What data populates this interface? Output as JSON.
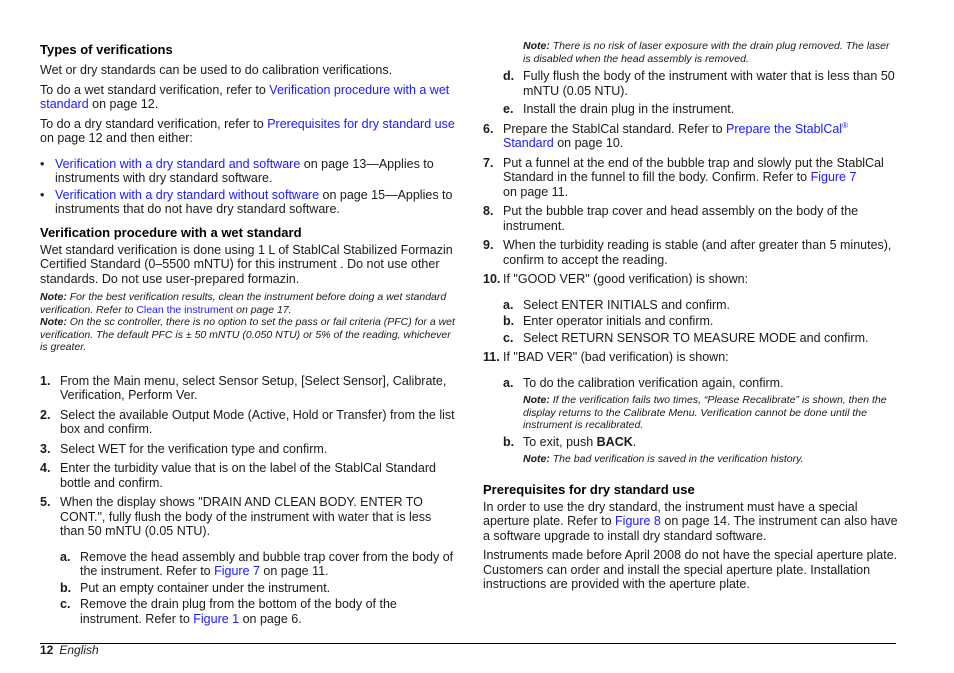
{
  "left": {
    "types": {
      "heading": "Types of verifications",
      "p1": "Wet or dry standards can be used to do calibration verifications.",
      "p2_pre": "To do a wet standard verification, refer to ",
      "p2_link": "Verification procedure with a wet standard",
      "p2_post": " on page 12.",
      "p3_pre": "To do a dry standard verification, refer to ",
      "p3_link": "Prerequisites for dry standard use",
      "p3_post": " on page 12 and then either:",
      "bullets": [
        {
          "link": "Verification with a dry standard and software",
          "text": " on page 13—Applies to instruments with dry standard software."
        },
        {
          "link": "Verification with a dry standard without software",
          "text": " on page 15—Applies to instruments that do not have dry standard software."
        }
      ],
      "bullet_glyph": "•"
    },
    "wet": {
      "heading": "Verification procedure with a wet standard",
      "intro": "Wet standard verification is done using 1 L of StablCal Stabilized Formazin Certified Standard (0–5500 mNTU) for this instrument . Do not use other standards. Do not use user-prepared formazin.",
      "note1_label": "Note:",
      "note1_pre": " For the best verification results, clean the instrument before doing a wet standard verification. Refer to ",
      "note1_link": "Clean the instrument",
      "note1_post": " on page 17.",
      "note2_label": "Note:",
      "note2_text": " On the sc controller, there is no option to set the pass or fail criteria (PFC) for a wet verification. The default PFC is ± 50 mNTU (0.050 NTU) or 5% of the reading, whichever is greater.",
      "steps": [
        {
          "num": "1.",
          "text": "From the Main menu, select Sensor Setup, [Select Sensor], Calibrate, Verification, Perform Ver."
        },
        {
          "num": "2.",
          "text": "Select the available Output Mode (Active, Hold or Transfer) from the list box and confirm."
        },
        {
          "num": "3.",
          "text": "Select WET for the verification type and confirm."
        },
        {
          "num": "4.",
          "text": "Enter the turbidity value that is on the label of the StablCal Standard bottle and confirm."
        },
        {
          "num": "5.",
          "text": "When the display shows \"DRAIN AND CLEAN BODY. ENTER TO CONT.\", fully flush the body of the instrument with water that is less than 50 mNTU (0.05 NTU)."
        }
      ],
      "step5_subs": [
        {
          "letter": "a.",
          "pre": "Remove the head assembly and bubble trap cover from the body of the instrument. Refer to ",
          "link": "Figure 7",
          "post": " on page 11."
        },
        {
          "letter": "b.",
          "pre": "Put an empty container under the instrument.",
          "link": "",
          "post": ""
        },
        {
          "letter": "c.",
          "pre": "Remove the drain plug from the bottom of the body of the instrument. Refer to ",
          "link": "Figure 1",
          "post": " on page 6."
        }
      ]
    }
  },
  "right": {
    "laser_note_label": "Note:",
    "laser_note_text": " There is no risk of laser exposure with the drain plug removed. The laser is disabled when the head assembly is removed.",
    "step5_subs_cont": [
      {
        "letter": "d.",
        "text": "Fully flush the body of the instrument with water that is less than 50 mNTU (0.05 NTU)."
      },
      {
        "letter": "e.",
        "text": "Install the drain plug in the instrument."
      }
    ],
    "step6": {
      "num": "6.",
      "pre": "Prepare the StablCal standard. Refer to ",
      "link": "Prepare the StablCal",
      "sup": "®",
      "link2": "Standard",
      "post": " on page 10."
    },
    "step7": {
      "num": "7.",
      "pre": "Put a funnel at the end of the bubble trap and slowly put the StablCal Standard in the funnel to fill the body. Confirm. Refer to ",
      "link": "Figure 7",
      "post": " on page 11."
    },
    "step8": {
      "num": "8.",
      "text": "Put the bubble trap cover and head assembly on the body of the instrument."
    },
    "step9": {
      "num": "9.",
      "text": "When the turbidity reading is stable (and after greater than 5 minutes), confirm to accept the reading."
    },
    "step10": {
      "num": "10.",
      "text": "If \"GOOD VER\" (good verification) is shown:"
    },
    "step10_subs": [
      {
        "letter": "a.",
        "text": "Select ENTER INITIALS and confirm."
      },
      {
        "letter": "b.",
        "text": "Enter operator initials and confirm."
      },
      {
        "letter": "c.",
        "text": "Select RETURN SENSOR TO MEASURE MODE and confirm."
      }
    ],
    "step11": {
      "num": "11.",
      "text": "If \"BAD VER\" (bad verification) is shown:"
    },
    "step11_a": {
      "letter": "a.",
      "text": "To do the calibration verification again, confirm."
    },
    "step11_a_note_label": "Note:",
    "step11_a_note": " If the verification fails two times, “Please Recalibrate” is shown, then the display returns to the Calibrate Menu. Verification cannot be done until the instrument is recalibrated.",
    "step11_b": {
      "letter": "b.",
      "pre": "To exit, push ",
      "bold": "BACK",
      "post": "."
    },
    "step11_b_note_label": "Note:",
    "step11_b_note": " The bad verification is saved in the verification history.",
    "prereq": {
      "heading": "Prerequisites for dry standard use",
      "p1_pre": "In order to use the dry standard, the instrument must have a special aperture plate. Refer to ",
      "p1_link": "Figure 8",
      "p1_post": " on page 14. The instrument can also have a software upgrade to install dry standard software.",
      "p2": "Instruments made before April 2008 do not have the special aperture plate. Customers can order and install the special aperture plate. Installation instructions are provided with the aperture plate."
    }
  },
  "footer": {
    "page_number": "12",
    "language": "English"
  },
  "colors": {
    "link": "#1a1aff",
    "text": "#1a1a1a"
  }
}
